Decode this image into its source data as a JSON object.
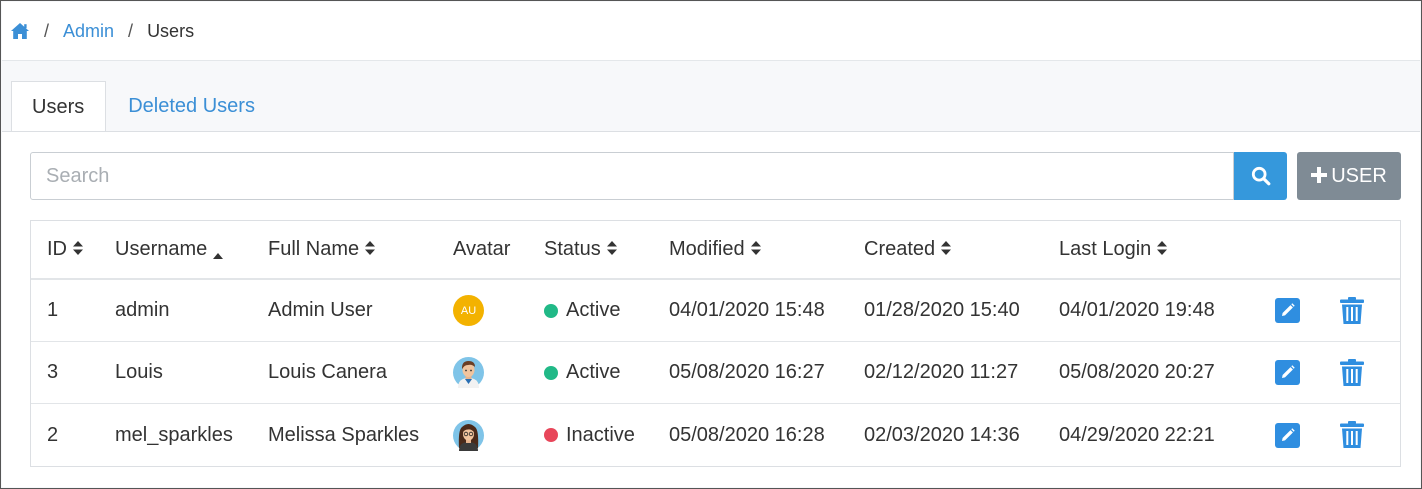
{
  "breadcrumb": {
    "home_icon": "home-icon",
    "items": [
      {
        "label": "Admin"
      },
      {
        "label": "Users"
      }
    ],
    "separator": "/"
  },
  "tabs": [
    {
      "label": "Users",
      "active": true
    },
    {
      "label": "Deleted Users",
      "active": false
    }
  ],
  "search": {
    "placeholder": "Search",
    "value": "",
    "button_icon": "search-icon"
  },
  "add_button": {
    "icon": "plus-icon",
    "label": "USER"
  },
  "table": {
    "columns": [
      {
        "label": "ID",
        "sort": "both"
      },
      {
        "label": "Username",
        "sort": "asc"
      },
      {
        "label": "Full Name",
        "sort": "both"
      },
      {
        "label": "Avatar",
        "sort": "none"
      },
      {
        "label": "Status",
        "sort": "both"
      },
      {
        "label": "Modified",
        "sort": "both"
      },
      {
        "label": "Created",
        "sort": "both"
      },
      {
        "label": "Last Login",
        "sort": "both"
      }
    ],
    "rows": [
      {
        "id": "1",
        "username": "admin",
        "full_name": "Admin User",
        "avatar": {
          "type": "initials",
          "initials": "AU",
          "color": "#f3b200"
        },
        "status": "Active",
        "status_color": "#21b987",
        "modified": "04/01/2020 15:48",
        "created": "01/28/2020 15:40",
        "last_login": "04/01/2020 19:48"
      },
      {
        "id": "3",
        "username": "Louis",
        "full_name": "Louis Canera",
        "avatar": {
          "type": "image",
          "icon": "male-avatar-icon"
        },
        "status": "Active",
        "status_color": "#21b987",
        "modified": "05/08/2020 16:27",
        "created": "02/12/2020 11:27",
        "last_login": "05/08/2020 20:27"
      },
      {
        "id": "2",
        "username": "mel_sparkles",
        "full_name": "Melissa Sparkles",
        "avatar": {
          "type": "image",
          "icon": "female-avatar-icon"
        },
        "status": "Inactive",
        "status_color": "#e8465a",
        "modified": "05/08/2020 16:28",
        "created": "02/03/2020 14:36",
        "last_login": "04/29/2020 22:21"
      }
    ],
    "row_actions": {
      "edit_icon": "edit-icon",
      "delete_icon": "trash-icon"
    }
  },
  "colors": {
    "link": "#3b8fd6",
    "primary_button": "#3598dc",
    "secondary_button": "#7f8b95",
    "action_icon": "#2f8ee0"
  }
}
